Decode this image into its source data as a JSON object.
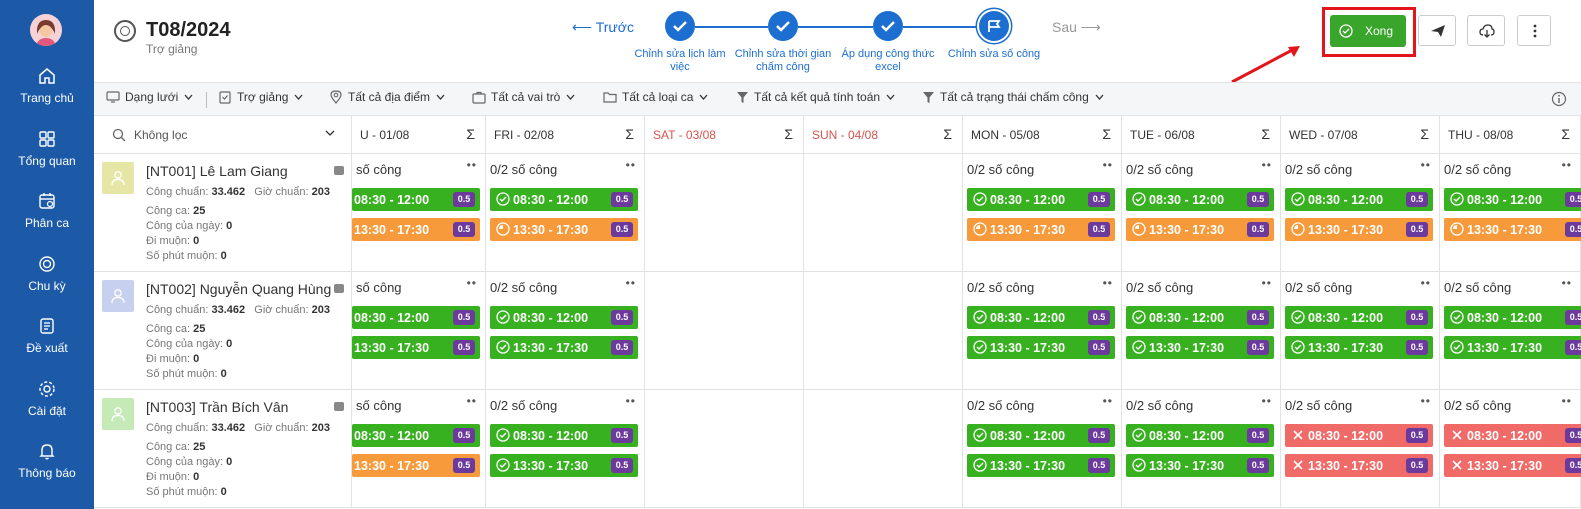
{
  "sidebar": {
    "items": [
      {
        "label": "Trang chủ",
        "icon": "home-icon"
      },
      {
        "label": "Tổng quan",
        "icon": "grid-icon"
      },
      {
        "label": "Phân ca",
        "icon": "calendar-icon"
      },
      {
        "label": "Chu kỳ",
        "icon": "cycle-icon"
      },
      {
        "label": "Đề xuất",
        "icon": "document-icon"
      },
      {
        "label": "Cài đặt",
        "icon": "gear-icon"
      },
      {
        "label": "Thông báo",
        "icon": "bell-icon"
      }
    ],
    "color": "#1c5aa8"
  },
  "header": {
    "title": "T08/2024",
    "subtitle": "Trợ giảng",
    "prev_label": "⟵ Trước",
    "next_label": "Sau ⟶",
    "steps": [
      {
        "label": "Chỉnh sửa lịch làm việc",
        "status": "done"
      },
      {
        "label": "Chỉnh sửa thời gian chấm công",
        "status": "done"
      },
      {
        "label": "Áp dụng công thức excel",
        "status": "done"
      },
      {
        "label": "Chỉnh sửa số công",
        "status": "current"
      }
    ],
    "done_button_label": "Xong"
  },
  "filters": {
    "view": "Dạng lưới",
    "role_group": "Trợ giảng",
    "location": "Tất cả địa điểm",
    "roles": "Tất cả vai trò",
    "shift_types": "Tất cả loại ca",
    "results": "Tất cả kết quả tính toán",
    "statuses": "Tất cả trạng thái chấm công"
  },
  "search": {
    "placeholder": "Không lọc"
  },
  "days": [
    {
      "label": "U - 01/08",
      "weekend": false
    },
    {
      "label": "FRI - 02/08",
      "weekend": false
    },
    {
      "label": "SAT - 03/08",
      "weekend": true
    },
    {
      "label": "SUN - 04/08",
      "weekend": true
    },
    {
      "label": "MON - 05/08",
      "weekend": false
    },
    {
      "label": "TUE - 06/08",
      "weekend": false
    },
    {
      "label": "WED - 07/08",
      "weekend": false
    },
    {
      "label": "THU - 08/08",
      "weekend": false
    }
  ],
  "sum_symbol": "Σ",
  "employee_labels": {
    "standard_work": "Công chuẩn:",
    "standard_hours": "Giờ chuẩn:",
    "shift_work": "Công ca:",
    "day_work": "Công của ngày:",
    "late": "Đi muộn:",
    "late_minutes": "Số phút muộn:"
  },
  "employees": [
    {
      "name": "[NT001] Lê Lam Giang",
      "standard_work": "33.462",
      "standard_hours": "203",
      "shift_work": "25",
      "day_work": "0",
      "late": "0",
      "late_minutes": "0",
      "avatar_color": "#e6e6a6"
    },
    {
      "name": "[NT002] Nguyễn Quang Hùng",
      "standard_work": "33.462",
      "standard_hours": "203",
      "shift_work": "25",
      "day_work": "0",
      "late": "0",
      "late_minutes": "0",
      "avatar_color": "#c8d0f0"
    },
    {
      "name": "[NT003] Trần Bích Vân",
      "standard_work": "33.462",
      "standard_hours": "203",
      "shift_work": "25",
      "day_work": "0",
      "late": "0",
      "late_minutes": "0",
      "avatar_color": "#c6e9b8"
    }
  ],
  "work_labels": {
    "first_col": "số công",
    "full": "0/2 số công"
  },
  "schedule": [
    [
      [
        {
          "time": "08:30 - 12:00",
          "status": "green",
          "badge": "0.5"
        },
        {
          "time": "13:30 - 17:30",
          "status": "orange",
          "badge": "0.5"
        }
      ],
      [
        {
          "time": "08:30 - 12:00",
          "status": "green",
          "badge": "0.5"
        },
        {
          "time": "13:30 - 17:30",
          "status": "orange",
          "badge": "0.5"
        }
      ],
      [],
      [],
      [
        {
          "time": "08:30 - 12:00",
          "status": "green",
          "badge": "0.5"
        },
        {
          "time": "13:30 - 17:30",
          "status": "orange",
          "badge": "0.5"
        }
      ],
      [
        {
          "time": "08:30 - 12:00",
          "status": "green",
          "badge": "0.5"
        },
        {
          "time": "13:30 - 17:30",
          "status": "orange",
          "badge": "0.5"
        }
      ],
      [
        {
          "time": "08:30 - 12:00",
          "status": "green",
          "badge": "0.5"
        },
        {
          "time": "13:30 - 17:30",
          "status": "orange",
          "badge": "0.5"
        }
      ],
      [
        {
          "time": "08:30 - 12:00",
          "status": "green",
          "badge": "0.5"
        },
        {
          "time": "13:30 - 17:30",
          "status": "orange",
          "badge": "0.5"
        }
      ]
    ],
    [
      [
        {
          "time": "08:30 - 12:00",
          "status": "green",
          "badge": "0.5"
        },
        {
          "time": "13:30 - 17:30",
          "status": "green",
          "badge": "0.5"
        }
      ],
      [
        {
          "time": "08:30 - 12:00",
          "status": "green",
          "badge": "0.5"
        },
        {
          "time": "13:30 - 17:30",
          "status": "green",
          "badge": "0.5"
        }
      ],
      [],
      [],
      [
        {
          "time": "08:30 - 12:00",
          "status": "green",
          "badge": "0.5"
        },
        {
          "time": "13:30 - 17:30",
          "status": "green",
          "badge": "0.5"
        }
      ],
      [
        {
          "time": "08:30 - 12:00",
          "status": "green",
          "badge": "0.5"
        },
        {
          "time": "13:30 - 17:30",
          "status": "green",
          "badge": "0.5"
        }
      ],
      [
        {
          "time": "08:30 - 12:00",
          "status": "green",
          "badge": "0.5"
        },
        {
          "time": "13:30 - 17:30",
          "status": "green",
          "badge": "0.5"
        }
      ],
      [
        {
          "time": "08:30 - 12:00",
          "status": "green",
          "badge": "0.5"
        },
        {
          "time": "13:30 - 17:30",
          "status": "green",
          "badge": "0.5"
        }
      ]
    ],
    [
      [
        {
          "time": "08:30 - 12:00",
          "status": "green",
          "badge": "0.5"
        },
        {
          "time": "13:30 - 17:30",
          "status": "orange",
          "badge": "0.5"
        }
      ],
      [
        {
          "time": "08:30 - 12:00",
          "status": "green",
          "badge": "0.5"
        },
        {
          "time": "13:30 - 17:30",
          "status": "green",
          "badge": "0.5"
        }
      ],
      [],
      [],
      [
        {
          "time": "08:30 - 12:00",
          "status": "green",
          "badge": "0.5"
        },
        {
          "time": "13:30 - 17:30",
          "status": "green",
          "badge": "0.5"
        }
      ],
      [
        {
          "time": "08:30 - 12:00",
          "status": "green",
          "badge": "0.5"
        },
        {
          "time": "13:30 - 17:30",
          "status": "green",
          "badge": "0.5"
        }
      ],
      [
        {
          "time": "08:30 - 12:00",
          "status": "red",
          "badge": "0.5"
        },
        {
          "time": "13:30 - 17:30",
          "status": "red",
          "badge": "0.5"
        }
      ],
      [
        {
          "time": "08:30 - 12:00",
          "status": "red",
          "badge": "0.5"
        },
        {
          "time": "13:30 - 17:30",
          "status": "red",
          "badge": "0.5"
        }
      ]
    ]
  ],
  "colors": {
    "accent": "#1c6fd1",
    "done": "#3aa52b",
    "highlight": "#e4141b",
    "badge": "#6c3a9c"
  }
}
